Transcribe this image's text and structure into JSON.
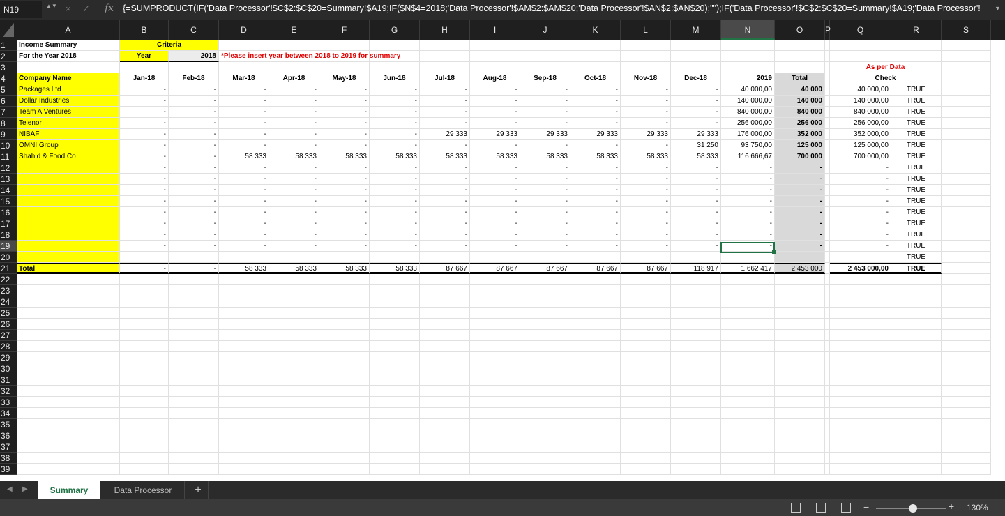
{
  "name_box": "N19",
  "formula": "{=SUMPRODUCT(IF('Data Processor'!$C$2:$C$20=Summary!$A19;IF($N$4=2018;'Data Processor'!$AM$2:$AM$20;'Data Processor'!$AN$2:$AN$20);\"\");IF('Data Processor'!$C$2:$C$20=Summary!$A19;'Data Processor'!",
  "icons": {
    "cancel": "×",
    "enter": "✓",
    "fx": "fx",
    "expand": "▼",
    "name_arrows": "▲▼"
  },
  "columns": [
    "A",
    "B",
    "C",
    "D",
    "E",
    "F",
    "G",
    "H",
    "I",
    "J",
    "K",
    "L",
    "M",
    "N",
    "O",
    "P",
    "Q",
    "R",
    "S"
  ],
  "selected_column": "N",
  "selected_row": 19,
  "sheet": {
    "title": "Income Summary",
    "subtitle": "For the Year 2018",
    "criteria_label": "Criteria",
    "year_label": "Year",
    "year_value": "2018",
    "note": "*Please insert year between 2018 to 2019 for summary",
    "as_per_data": "As per Data",
    "check": "Check",
    "company_header": "Company Name",
    "month_headers": [
      "Jan-18",
      "Feb-18",
      "Mar-18",
      "Apr-18",
      "May-18",
      "Jun-18",
      "Jul-18",
      "Aug-18",
      "Sep-18",
      "Oct-18",
      "Nov-18",
      "Dec-18"
    ],
    "year_header": "2019",
    "total_header": "Total",
    "total_label": "Total",
    "rows": [
      {
        "name": "Packages Ltd",
        "m": [
          "-",
          "-",
          "-",
          "-",
          "-",
          "-",
          "-",
          "-",
          "-",
          "-",
          "-",
          "-"
        ],
        "y": "40 000,00",
        "t": "40 000",
        "q": "40 000,00",
        "r": "TRUE"
      },
      {
        "name": "Dollar Industries",
        "m": [
          "-",
          "-",
          "-",
          "-",
          "-",
          "-",
          "-",
          "-",
          "-",
          "-",
          "-",
          "-"
        ],
        "y": "140 000,00",
        "t": "140 000",
        "q": "140 000,00",
        "r": "TRUE"
      },
      {
        "name": "Team A Ventures",
        "m": [
          "-",
          "-",
          "-",
          "-",
          "-",
          "-",
          "-",
          "-",
          "-",
          "-",
          "-",
          "-"
        ],
        "y": "840 000,00",
        "t": "840 000",
        "q": "840 000,00",
        "r": "TRUE"
      },
      {
        "name": "Telenor",
        "m": [
          "-",
          "-",
          "-",
          "-",
          "-",
          "-",
          "-",
          "-",
          "-",
          "-",
          "-",
          "-"
        ],
        "y": "256 000,00",
        "t": "256 000",
        "q": "256 000,00",
        "r": "TRUE"
      },
      {
        "name": "NIBAF",
        "m": [
          "-",
          "-",
          "-",
          "-",
          "-",
          "-",
          "29 333",
          "29 333",
          "29 333",
          "29 333",
          "29 333",
          "29 333"
        ],
        "y": "176 000,00",
        "t": "352 000",
        "q": "352 000,00",
        "r": "TRUE"
      },
      {
        "name": "OMNI Group",
        "m": [
          "-",
          "-",
          "-",
          "-",
          "-",
          "-",
          "-",
          "-",
          "-",
          "-",
          "-",
          "31 250"
        ],
        "y": "93 750,00",
        "t": "125 000",
        "q": "125 000,00",
        "r": "TRUE"
      },
      {
        "name": "Shahid & Food Co",
        "m": [
          "-",
          "-",
          "58 333",
          "58 333",
          "58 333",
          "58 333",
          "58 333",
          "58 333",
          "58 333",
          "58 333",
          "58 333",
          "58 333"
        ],
        "y": "116 666,67",
        "t": "700 000",
        "q": "700 000,00",
        "r": "TRUE"
      },
      {
        "name": "",
        "m": [
          "-",
          "-",
          "-",
          "-",
          "-",
          "-",
          "-",
          "-",
          "-",
          "-",
          "-",
          "-"
        ],
        "y": "-",
        "t": "-",
        "q": "-",
        "r": "TRUE"
      },
      {
        "name": "",
        "m": [
          "-",
          "-",
          "-",
          "-",
          "-",
          "-",
          "-",
          "-",
          "-",
          "-",
          "-",
          "-"
        ],
        "y": "-",
        "t": "-",
        "q": "-",
        "r": "TRUE"
      },
      {
        "name": "",
        "m": [
          "-",
          "-",
          "-",
          "-",
          "-",
          "-",
          "-",
          "-",
          "-",
          "-",
          "-",
          "-"
        ],
        "y": "-",
        "t": "-",
        "q": "-",
        "r": "TRUE"
      },
      {
        "name": "",
        "m": [
          "-",
          "-",
          "-",
          "-",
          "-",
          "-",
          "-",
          "-",
          "-",
          "-",
          "-",
          "-"
        ],
        "y": "-",
        "t": "-",
        "q": "-",
        "r": "TRUE"
      },
      {
        "name": "",
        "m": [
          "-",
          "-",
          "-",
          "-",
          "-",
          "-",
          "-",
          "-",
          "-",
          "-",
          "-",
          "-"
        ],
        "y": "-",
        "t": "-",
        "q": "-",
        "r": "TRUE"
      },
      {
        "name": "",
        "m": [
          "-",
          "-",
          "-",
          "-",
          "-",
          "-",
          "-",
          "-",
          "-",
          "-",
          "-",
          "-"
        ],
        "y": "-",
        "t": "-",
        "q": "-",
        "r": "TRUE"
      },
      {
        "name": "",
        "m": [
          "-",
          "-",
          "-",
          "-",
          "-",
          "-",
          "-",
          "-",
          "-",
          "-",
          "-",
          "-"
        ],
        "y": "-",
        "t": "-",
        "q": "-",
        "r": "TRUE"
      },
      {
        "name": "",
        "m": [
          "-",
          "-",
          "-",
          "-",
          "-",
          "-",
          "-",
          "-",
          "-",
          "-",
          "-",
          "-"
        ],
        "y": "-",
        "t": "-",
        "q": "-",
        "r": "TRUE"
      },
      {
        "name": "",
        "m": [
          "",
          "",
          "",
          "",
          "",
          "",
          "",
          "",
          "",
          "",
          "",
          ""
        ],
        "y": "",
        "t": "",
        "q": "",
        "r": "TRUE"
      }
    ],
    "totals": {
      "m": [
        "-",
        "-",
        "58 333",
        "58 333",
        "58 333",
        "58 333",
        "87 667",
        "87 667",
        "87 667",
        "87 667",
        "87 667",
        "118 917"
      ],
      "y": "1 662 417",
      "t": "2 453 000",
      "q": "2 453 000,00",
      "r": "TRUE"
    }
  },
  "tabs": [
    {
      "label": "Summary",
      "active": true
    },
    {
      "label": "Data Processor",
      "active": false
    }
  ],
  "add_tab": "+",
  "zoom": {
    "minus": "−",
    "plus": "+",
    "level": "130%"
  }
}
